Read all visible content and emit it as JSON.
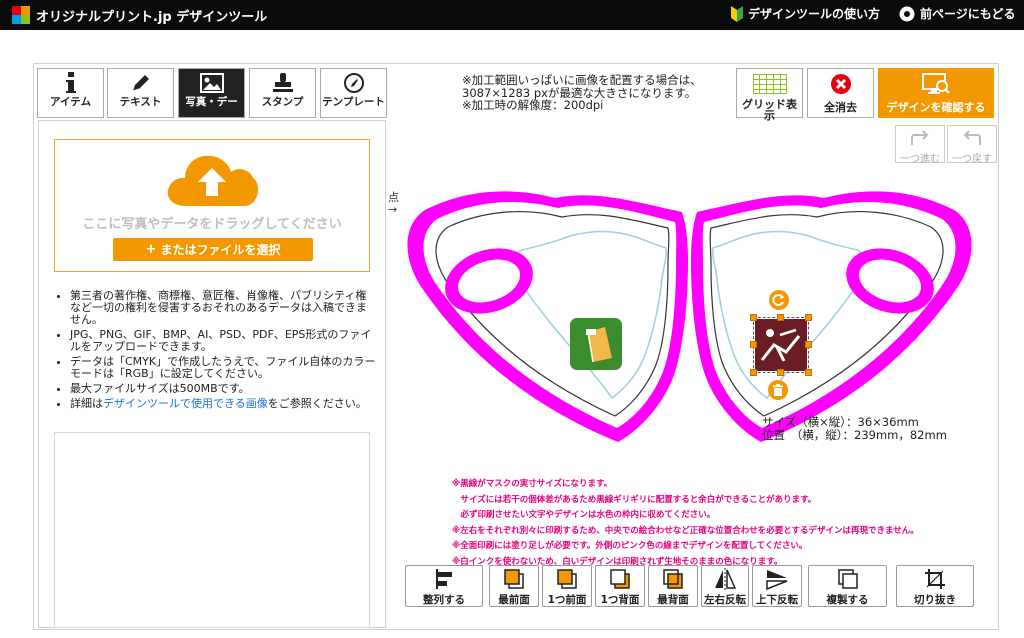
{
  "header": {
    "title": "オリジナルプリント.jp デザインツール",
    "help_link": "デザインツールの使い方",
    "back_link": "前ページにもどる"
  },
  "tabs": [
    {
      "label": "アイテム"
    },
    {
      "label": "テキスト"
    },
    {
      "label": "写真・デー"
    },
    {
      "label": "スタンプ"
    },
    {
      "label": "テンプレート"
    }
  ],
  "upload": {
    "drop_text": "ここに写真やデータをドラッグしてください",
    "file_button": "またはファイルを選択"
  },
  "notes": {
    "n1": "第三者の著作権、商標権、意匠権、肖像権、パブリシティ権など一切の権利を侵害するおそれのあるデータは入稿できません。",
    "n2": "JPG、PNG、GIF、BMP、AI、PSD、PDF、EPS形式のファイルをアップロードできます。",
    "n3": "データは「CMYK」で作成したうえで、ファイル自体のカラーモードは「RGB」に設定してください。",
    "n4": "最大ファイルサイズは500MBです。",
    "n5_pre": "詳細は",
    "n5_link": "デザインツールで使用できる画像",
    "n5_post": "をご参照ください。"
  },
  "info": {
    "line1": "※加工範囲いっぱいに画像を配置する場合は、",
    "line2": "3087×1283 pxが最適な大きさになります。",
    "line3": "※加工時の解像度：200dpi"
  },
  "right_buttons": {
    "grid": "グリッド表示",
    "clear": "全消去",
    "confirm": "デザインを確認する"
  },
  "history": {
    "redo": "一つ進む",
    "undo": "一つ戻す"
  },
  "canvas": {
    "partial_label": "点",
    "arrow": "→",
    "size_label": "サイズ（横×縦）：36×36mm",
    "position_label": "位置　（横，縦）：239mm，82mm"
  },
  "warnings": [
    "※黒線がマスクの実寸サイズになります。",
    "　サイズには若干の個体差があるため黒線ギリギリに配置すると余白ができることがあります。",
    "　必ず印刷させたい文字やデザインは水色の枠内に収めてください。",
    "※左右をそれぞれ別々に印刷するため、中央での絵合わせなど正確な位置合わせを必要とするデザインは再現できません。",
    "※全面印刷には塗り足しが必要です。外側のピンク色の線までデザインを配置してください。",
    "※白インクを使わないため、白いデザインは印刷されず生地そのままの色になります。"
  ],
  "bottom_buttons": {
    "align": "整列する",
    "front": "最前面",
    "forward": "1つ前面",
    "backward": "1つ背面",
    "back": "最背面",
    "flip_h": "左右反転",
    "flip_v": "上下反転",
    "duplicate": "複製する",
    "crop": "切り抜き"
  },
  "colors": {
    "accent": "#f39800",
    "magenta": "#ff00ff",
    "light_blue": "#9dcfe0",
    "danger": "#e60012"
  }
}
